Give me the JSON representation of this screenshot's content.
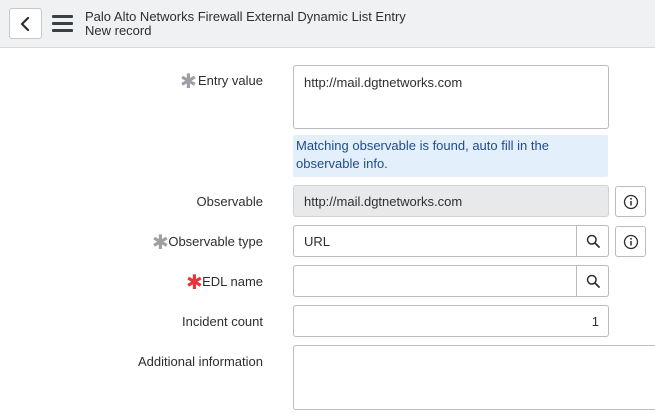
{
  "header": {
    "title": "Palo Alto Networks Firewall External Dynamic List Entry",
    "subtitle": "New record"
  },
  "form": {
    "entry_value": {
      "label": "Entry value",
      "value": "http://mail.dgtnetworks.com",
      "required": true,
      "hint": "Matching observable is found, auto fill in the observable info."
    },
    "observable": {
      "label": "Observable",
      "value": "http://mail.dgtnetworks.com",
      "readonly": true
    },
    "observable_type": {
      "label": "Observable type",
      "value": "URL",
      "required": true
    },
    "edl_name": {
      "label": "EDL name",
      "value": "",
      "required": true
    },
    "incident_count": {
      "label": "Incident count",
      "value": "1"
    },
    "additional_information": {
      "label": "Additional information",
      "value": ""
    }
  },
  "colors": {
    "required_filled": "#9aa0a5",
    "required_empty": "#e8323c",
    "hint_bg": "#e3effb",
    "hint_text": "#1f4b8e"
  },
  "icons": {
    "back": "chevron-left-icon",
    "menu": "hamburger-menu-icon",
    "lookup": "search-icon",
    "info": "info-icon",
    "required": "asterisk-icon"
  }
}
